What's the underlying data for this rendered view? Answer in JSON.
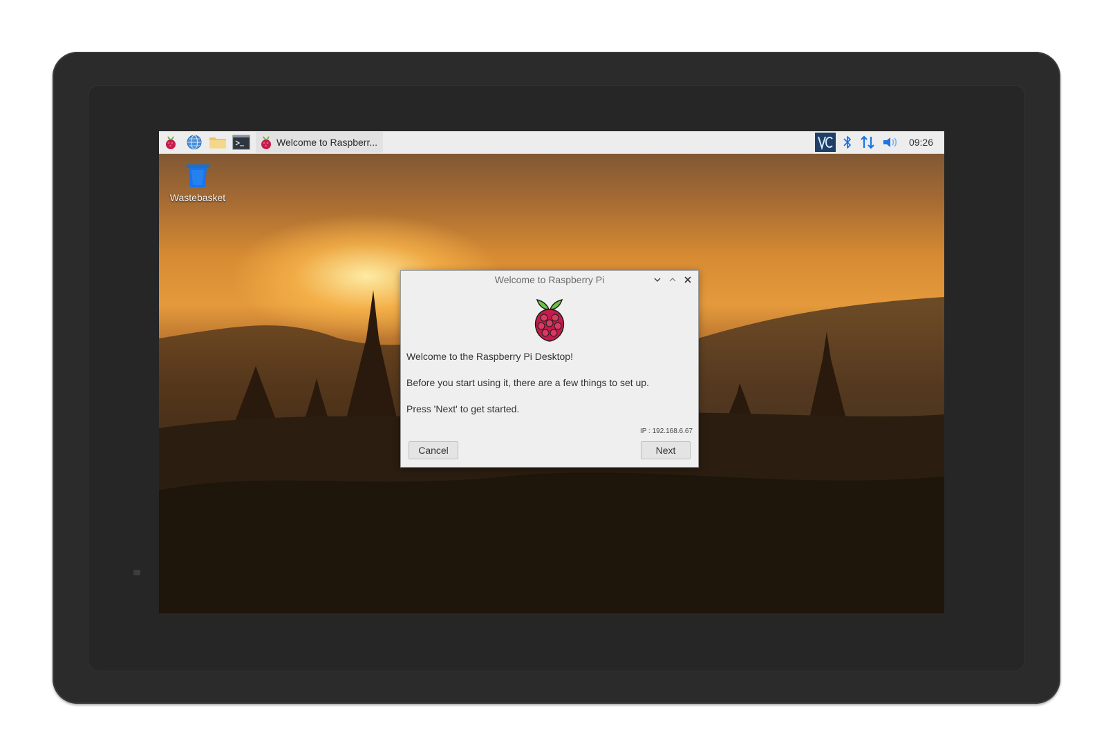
{
  "panel": {
    "task_button_label": "Welcome to Raspberr...",
    "clock": "09:26"
  },
  "desktop": {
    "wastebasket_label": "Wastebasket"
  },
  "dialog": {
    "title": "Welcome to Raspberry Pi",
    "line1": "Welcome to the Raspberry Pi Desktop!",
    "line2": "Before you start using it, there are a few things to set up.",
    "line3": "Press 'Next' to get started.",
    "ip": "IP : 192.168.6.67",
    "cancel_label": "Cancel",
    "next_label": "Next"
  },
  "icons": {
    "menu": "raspberry-menu-icon",
    "browser": "globe-icon",
    "files": "folder-icon",
    "terminal": "terminal-icon",
    "vnc": "vnc-icon",
    "bluetooth": "bluetooth-icon",
    "network": "network-arrows-icon",
    "volume": "speaker-icon"
  },
  "colors": {
    "accent": "#1a73e8",
    "raspberry": "#c51a4a",
    "leaf": "#6cc04a"
  }
}
